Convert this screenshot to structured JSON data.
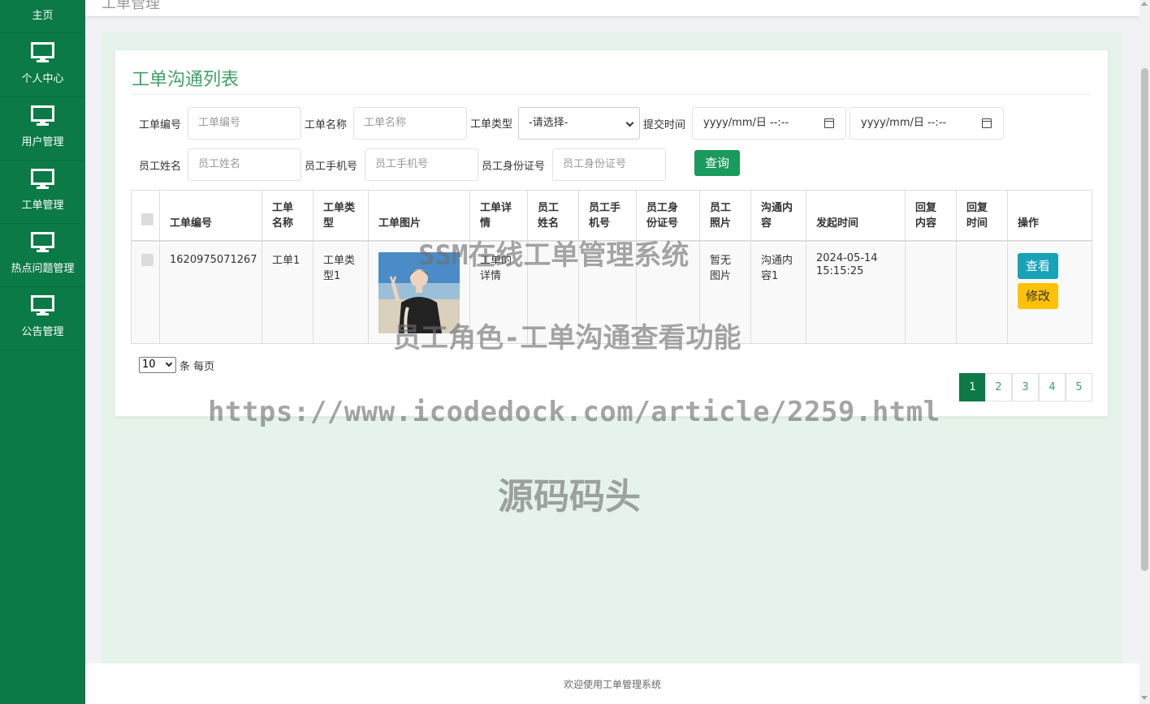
{
  "sidebar": {
    "items": [
      {
        "label": "主页",
        "icon": "home"
      },
      {
        "label": "个人中心",
        "icon": "monitor-icon"
      },
      {
        "label": "用户管理",
        "icon": "monitor-icon"
      },
      {
        "label": "工单管理",
        "icon": "monitor-icon"
      },
      {
        "label": "热点问题管理",
        "icon": "monitor-icon"
      },
      {
        "label": "公告管理",
        "icon": "monitor-icon"
      }
    ]
  },
  "header": {
    "breadcrumb": "工单管理"
  },
  "card": {
    "title": "工单沟通列表"
  },
  "filters": {
    "order_no": {
      "label": "工单编号",
      "placeholder": "工单编号"
    },
    "order_name": {
      "label": "工单名称",
      "placeholder": "工单名称"
    },
    "order_type": {
      "label": "工单类型",
      "value": "-请选择-"
    },
    "submit_time": {
      "label": "提交时间",
      "start": "yyyy/mm/日 --:--",
      "end": "yyyy/mm/日 --:--"
    },
    "employee_name": {
      "label": "员工姓名",
      "placeholder": "员工姓名"
    },
    "employee_phone": {
      "label": "员工手机号",
      "placeholder": "员工手机号"
    },
    "employee_id": {
      "label": "员工身份证号",
      "placeholder": "员工身份证号"
    },
    "search_label": "查询"
  },
  "table": {
    "headers": [
      "工单编号",
      "工单名称",
      "工单类型",
      "工单图片",
      "工单详情",
      "员工姓名",
      "员工手机号",
      "员工身份证号",
      "员工照片",
      "沟通内容",
      "发起时间",
      "回复内容",
      "回复时间",
      "操作"
    ],
    "headers_wrapped": [
      [
        "工单编号"
      ],
      [
        "工单",
        "名称"
      ],
      [
        "工单类",
        "型"
      ],
      [
        "工单图片"
      ],
      [
        "工单详",
        "情"
      ],
      [
        "员工",
        "姓名"
      ],
      [
        "员工手",
        "机号"
      ],
      [
        "员工身",
        "份证号"
      ],
      [
        "员工",
        "照片"
      ],
      [
        "沟通内",
        "容"
      ],
      [
        "发起时间"
      ],
      [
        "回复",
        "内容"
      ],
      [
        "回复",
        "时间"
      ],
      [
        "操作"
      ]
    ],
    "rows": [
      {
        "order_no": "1620975071267",
        "order_name": "工单1",
        "order_type": [
          "工单类",
          "型1"
        ],
        "order_detail": [
          "工单的",
          "详情"
        ],
        "employee_name": "",
        "employee_phone": "",
        "employee_id": "",
        "employee_photo": [
          "暂无",
          "图片"
        ],
        "content": [
          "沟通内",
          "容1"
        ],
        "time": [
          "2024-05-14",
          "15:15:25"
        ],
        "reply": "",
        "reply_time": "",
        "view_label": "查看",
        "edit_label": "修改"
      }
    ]
  },
  "pagination": {
    "page_size": "10",
    "page_size_suffix": "条 每页",
    "pages": [
      "1",
      "2",
      "3",
      "4",
      "5"
    ],
    "current": "1"
  },
  "footer": {
    "text": "欢迎使用工单管理系统"
  },
  "watermarks": {
    "line1": "SSM在线工单管理系统",
    "line2": "员工角色-工单沟通查看功能",
    "line3": "https://www.icodedock.com/article/2259.html",
    "line4": "源码码头"
  },
  "colors": {
    "sidebar": "#0b7a46",
    "accent": "#3ea167",
    "info": "#17a2b8",
    "warning": "#ffc107"
  }
}
